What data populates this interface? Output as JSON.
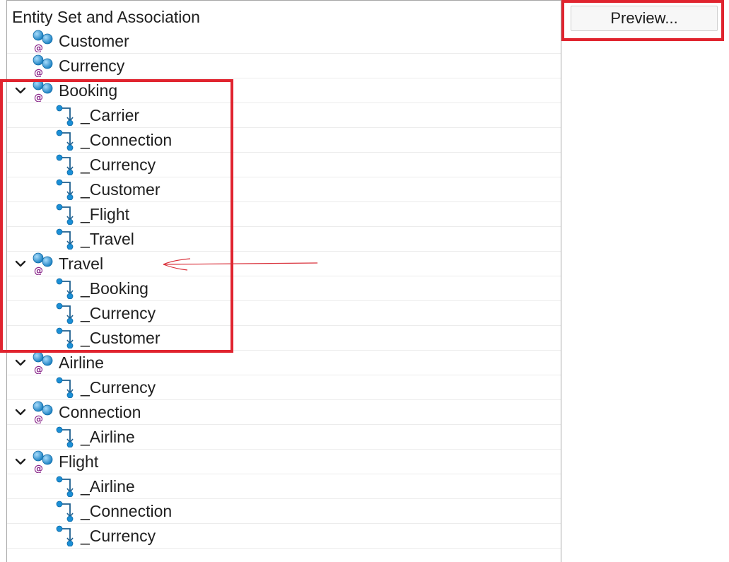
{
  "tree": {
    "header": "Entity Set and Association",
    "rows": [
      {
        "label": "Customer",
        "level": 0,
        "expanded": false,
        "icon": "entity-set-icon"
      },
      {
        "label": "Currency",
        "level": 0,
        "expanded": false,
        "icon": "entity-set-icon"
      },
      {
        "label": "Booking",
        "level": 0,
        "expanded": true,
        "icon": "entity-set-icon"
      },
      {
        "label": "_Carrier",
        "level": 1,
        "icon": "association-icon"
      },
      {
        "label": "_Connection",
        "level": 1,
        "icon": "association-icon"
      },
      {
        "label": "_Currency",
        "level": 1,
        "icon": "association-icon"
      },
      {
        "label": "_Customer",
        "level": 1,
        "icon": "association-icon"
      },
      {
        "label": "_Flight",
        "level": 1,
        "icon": "association-icon"
      },
      {
        "label": "_Travel",
        "level": 1,
        "icon": "association-icon"
      },
      {
        "label": "Travel",
        "level": 0,
        "expanded": true,
        "icon": "entity-set-icon"
      },
      {
        "label": "_Booking",
        "level": 1,
        "icon": "association-icon"
      },
      {
        "label": "_Currency",
        "level": 1,
        "icon": "association-icon"
      },
      {
        "label": "_Customer",
        "level": 1,
        "icon": "association-icon"
      },
      {
        "label": "Airline",
        "level": 0,
        "expanded": true,
        "icon": "entity-set-icon"
      },
      {
        "label": "_Currency",
        "level": 1,
        "icon": "association-icon"
      },
      {
        "label": "Connection",
        "level": 0,
        "expanded": true,
        "icon": "entity-set-icon"
      },
      {
        "label": "_Airline",
        "level": 1,
        "icon": "association-icon"
      },
      {
        "label": "Flight",
        "level": 0,
        "expanded": true,
        "icon": "entity-set-icon"
      },
      {
        "label": "_Airline",
        "level": 1,
        "icon": "association-icon"
      },
      {
        "label": "_Connection",
        "level": 1,
        "icon": "association-icon"
      },
      {
        "label": "_Currency",
        "level": 1,
        "icon": "association-icon"
      }
    ]
  },
  "right_panel": {
    "preview_button_label": "Preview..."
  },
  "colors": {
    "highlight": "#e0242f",
    "annotation_arrow": "#d9303a",
    "icon_blue": "#1b8fd6",
    "icon_at": "#8b2a8c"
  }
}
